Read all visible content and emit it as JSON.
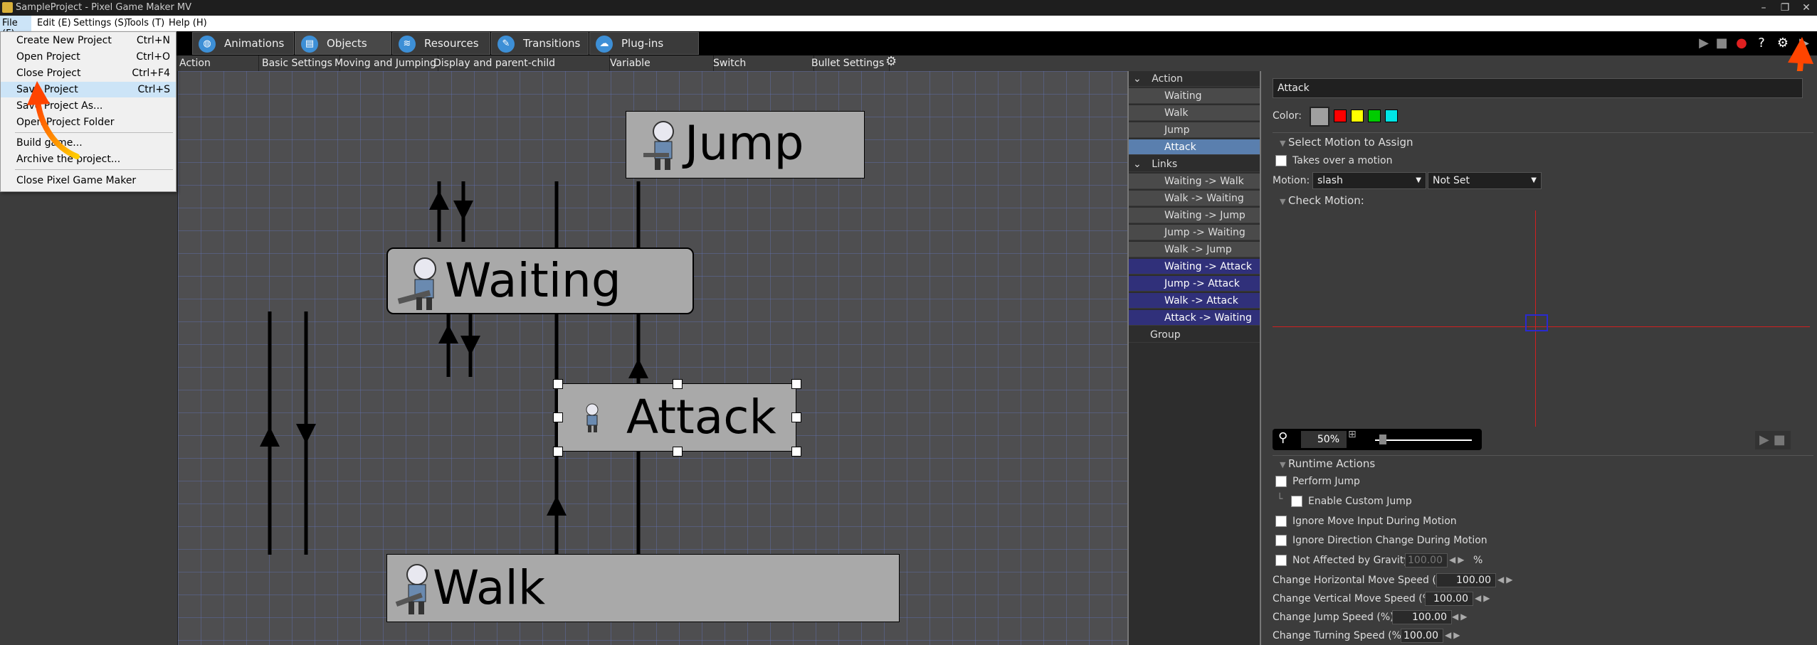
{
  "window": {
    "title": "SampleProject - Pixel Game Maker MV"
  },
  "menubar": [
    "File (F)",
    "Edit (E)",
    "Settings (S)",
    "Tools (T)",
    "Help (H)"
  ],
  "file_menu": [
    {
      "label": "Create New Project",
      "shortcut": "Ctrl+N"
    },
    {
      "label": "Open Project",
      "shortcut": "Ctrl+O"
    },
    {
      "label": "Close Project",
      "shortcut": "Ctrl+F4"
    },
    {
      "label": "Save Project",
      "shortcut": "Ctrl+S"
    },
    {
      "label": "Save Project As...",
      "shortcut": ""
    },
    {
      "label": "Open Project Folder",
      "shortcut": ""
    },
    {
      "label": "Build game...",
      "shortcut": ""
    },
    {
      "label": "Archive the project...",
      "shortcut": ""
    },
    {
      "label": "Close Pixel Game Maker",
      "shortcut": ""
    }
  ],
  "main_tabs": [
    "Animations",
    "Objects",
    "Resources",
    "Transitions",
    "Plug-ins"
  ],
  "sub_tabs": [
    "Action Programs",
    "Basic Settings",
    "Moving and Jumping",
    "Display and parent-child relationship",
    "Variable management",
    "Switch management",
    "Bullet Settings"
  ],
  "nodes": {
    "jump": "Jump",
    "waiting": "Waiting",
    "attack": "Attack",
    "walk": "Walk"
  },
  "tree": {
    "action_header": "Action",
    "actions": [
      "Waiting",
      "Walk",
      "Jump",
      "Attack"
    ],
    "links_header": "Links",
    "links": [
      "Waiting -> Walk",
      "Walk -> Waiting",
      "Waiting -> Jump",
      "Jump -> Waiting",
      "Walk -> Jump",
      "Waiting -> Attack",
      "Jump -> Attack",
      "Walk -> Attack",
      "Attack -> Waiting"
    ],
    "group": "Group"
  },
  "props": {
    "name": "Attack",
    "color_label": "Color:",
    "colors": [
      "#a0a0a0",
      "#ff0000",
      "#ffff00",
      "#00cc00",
      "#00e5e5"
    ],
    "select_motion": "Select Motion to Assign",
    "takes_over": "Takes over a motion",
    "motion_label": "Motion:",
    "motion_value": "slash",
    "motion_value2": "Not Set",
    "check_motion": "Check Motion:",
    "zoom": "50%",
    "runtime_actions": "Runtime Actions",
    "perform_jump": "Perform Jump",
    "enable_custom_jump": "Enable Custom Jump",
    "ignore_move_input": "Ignore Move Input During Motion",
    "ignore_direction": "Ignore Direction Change During Motion",
    "not_affected_gravity": "Not Affected by Gravity",
    "gravity_value": "100.00",
    "gravity_unit": "%",
    "h_speed_label": "Change Horizontal Move Speed (%):",
    "h_speed": "100.00",
    "v_speed_label": "Change Vertical Move Speed (%):",
    "v_speed": "100.00",
    "jump_speed_label": "Change Jump Speed (%):",
    "jump_speed": "100.00",
    "turn_speed_label": "Change Turning Speed (%):",
    "turn_speed": "100.00"
  },
  "icons": {
    "accent": "#3d8fd6",
    "arrow_gradient": [
      "#ff4400",
      "#ffcc00"
    ]
  }
}
